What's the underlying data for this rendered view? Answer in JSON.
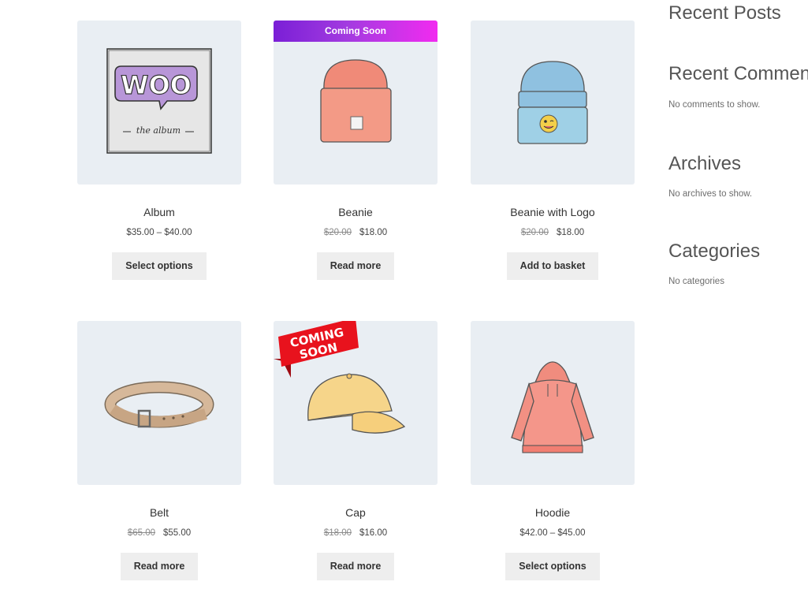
{
  "products": [
    {
      "name": "Album",
      "price": "$35.00 – $40.00",
      "old_price": "",
      "button": "Select options",
      "icon": "album-image"
    },
    {
      "name": "Beanie",
      "price": "$18.00",
      "old_price": "$20.00",
      "button": "Read more",
      "icon": "beanie-image",
      "badge": "Coming Soon"
    },
    {
      "name": "Beanie with Logo",
      "price": "$18.00",
      "old_price": "$20.00",
      "button": "Add to basket",
      "icon": "beanie-logo-image"
    },
    {
      "name": "Belt",
      "price": "$55.00",
      "old_price": "$65.00",
      "button": "Read more",
      "icon": "belt-image"
    },
    {
      "name": "Cap",
      "price": "$16.00",
      "old_price": "$18.00",
      "button": "Read more",
      "icon": "cap-image",
      "badge_lines": [
        "COMING",
        "SOON"
      ]
    },
    {
      "name": "Hoodie",
      "price": "$42.00 – $45.00",
      "old_price": "",
      "button": "Select options",
      "icon": "hoodie-image"
    }
  ],
  "album_art": {
    "logo": "WOO",
    "caption": "the album"
  },
  "sidebar": {
    "widgets": [
      {
        "title": "Recent Posts",
        "text": ""
      },
      {
        "title": "Recent Comments",
        "text": "No comments to show."
      },
      {
        "title": "Archives",
        "text": "No archives to show."
      },
      {
        "title": "Categories",
        "text": "No categories"
      }
    ]
  },
  "colors": {
    "thumb_bg": "#e9eef3",
    "button_bg": "#eeeeee",
    "banner_from": "#7a1fd6",
    "banner_to": "#f12bf0",
    "ribbon": "#e8121d"
  }
}
